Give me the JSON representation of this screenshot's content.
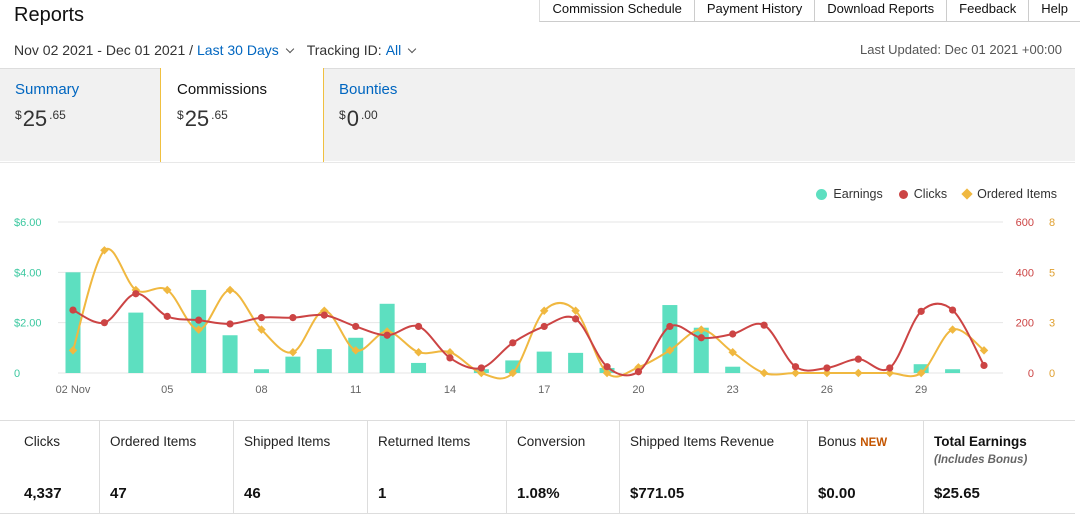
{
  "header": {
    "title": "Reports",
    "nav": [
      "Commission Schedule",
      "Payment History",
      "Download Reports",
      "Feedback",
      "Help"
    ],
    "date_range": "Nov 02 2021 - Dec 01 2021 /",
    "range_preset": "Last 30 Days",
    "tracking_label": "Tracking ID:",
    "tracking_value": "All",
    "last_updated": "Last Updated: Dec 01 2021 +00:00"
  },
  "tabs": [
    {
      "name": "Summary",
      "currency": "$",
      "whole": "25",
      "cents": ".65",
      "active": false
    },
    {
      "name": "Commissions",
      "currency": "$",
      "whole": "25",
      "cents": ".65",
      "active": true
    },
    {
      "name": "Bounties",
      "currency": "$",
      "whole": "0",
      "cents": ".00",
      "active": false
    }
  ],
  "colors": {
    "earnings": "#5ddfc0",
    "clicks": "#cc4444",
    "ordered": "#f0b840",
    "link": "#0066c0",
    "grid": "#e6e6e6"
  },
  "chart_data": {
    "type": "bar+line",
    "legend": [
      "Earnings",
      "Clicks",
      "Ordered Items"
    ],
    "legend_position": "top-right",
    "grid": true,
    "x_ticks": [
      "02 Nov",
      "05",
      "08",
      "11",
      "14",
      "17",
      "20",
      "23",
      "26",
      "29"
    ],
    "y_left": {
      "ticks": [
        "$6.00",
        "$4.00",
        "$2.00",
        "0"
      ],
      "range": [
        0,
        6
      ]
    },
    "y_mid": {
      "ticks": [
        "600",
        "400",
        "200",
        "0"
      ],
      "range": [
        0,
        600
      ]
    },
    "y_right": {
      "ticks": [
        "8",
        "5",
        "3",
        "0"
      ],
      "range": [
        0,
        8
      ]
    },
    "days": [
      "11/02",
      "11/03",
      "11/04",
      "11/05",
      "11/06",
      "11/07",
      "11/08",
      "11/09",
      "11/10",
      "11/11",
      "11/12",
      "11/13",
      "11/14",
      "11/15",
      "11/16",
      "11/17",
      "11/18",
      "11/19",
      "11/20",
      "11/21",
      "11/22",
      "11/23",
      "11/24",
      "11/25",
      "11/26",
      "11/27",
      "11/28",
      "11/29",
      "11/30",
      "12/01"
    ],
    "series": [
      {
        "name": "Earnings",
        "axis": "left",
        "values": [
          4.0,
          0,
          2.4,
          0,
          3.3,
          1.5,
          0.15,
          0.65,
          0.95,
          1.4,
          2.75,
          0.4,
          0,
          0.15,
          0.5,
          0.85,
          0.8,
          0.2,
          0,
          2.7,
          1.8,
          0.25,
          0,
          0,
          0,
          0,
          0,
          0.35,
          0.15,
          0
        ]
      },
      {
        "name": "Clicks",
        "axis": "mid",
        "values": [
          250,
          200,
          315,
          225,
          210,
          195,
          220,
          220,
          230,
          185,
          150,
          185,
          60,
          20,
          120,
          185,
          215,
          25,
          5,
          185,
          140,
          155,
          190,
          25,
          20,
          55,
          20,
          245,
          250,
          30
        ]
      },
      {
        "name": "Ordered Items",
        "axis": "right",
        "values": [
          1.2,
          6.5,
          4.4,
          4.4,
          2.3,
          4.4,
          2.3,
          1.1,
          3.3,
          1.2,
          2.2,
          1.1,
          1.1,
          0,
          0,
          3.3,
          3.3,
          0,
          0.3,
          1.2,
          2.3,
          1.1,
          0,
          0,
          0,
          0,
          0,
          0,
          2.3,
          1.2
        ]
      }
    ]
  },
  "stats": [
    {
      "label": "Clicks",
      "value": "4,337"
    },
    {
      "label": "Ordered Items",
      "value": "47"
    },
    {
      "label": "Shipped Items",
      "value": "46"
    },
    {
      "label": "Returned Items",
      "value": "1"
    },
    {
      "label": "Conversion",
      "value": "1.08%"
    },
    {
      "label": "Shipped Items Revenue",
      "value": "$771.05"
    },
    {
      "label": "Bonus",
      "badge": "NEW",
      "value": "$0.00"
    },
    {
      "label": "Total Earnings",
      "sub": "(Includes Bonus)",
      "value": "$25.65"
    }
  ]
}
